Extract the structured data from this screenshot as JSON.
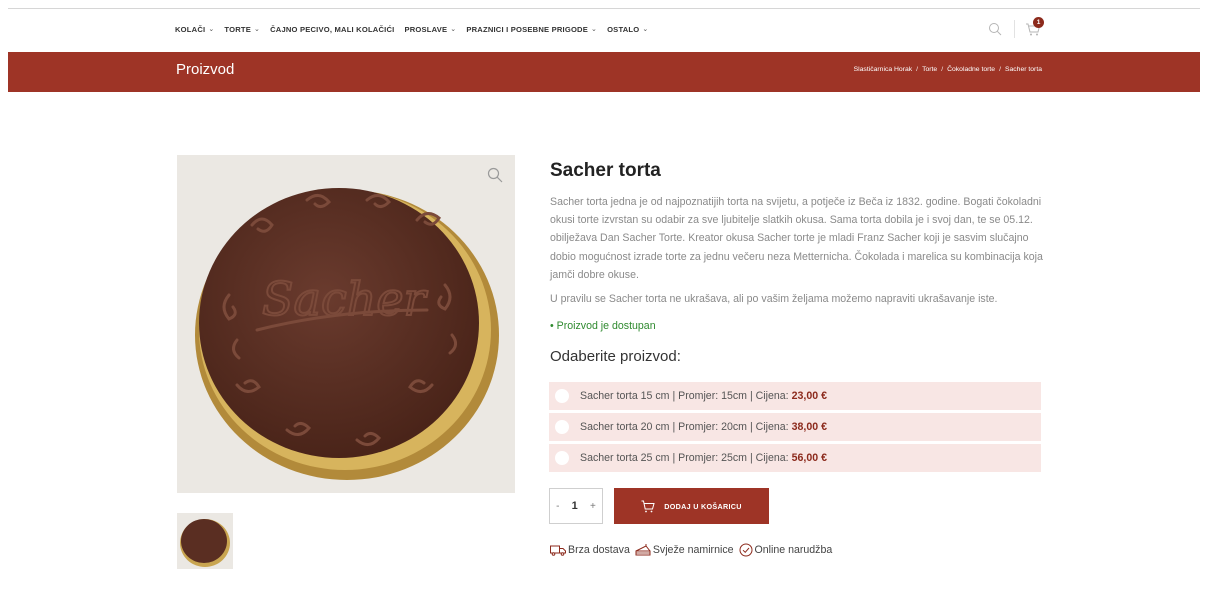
{
  "nav": {
    "items": [
      {
        "label": "KOLAČI",
        "has_dropdown": true
      },
      {
        "label": "TORTE",
        "has_dropdown": true
      },
      {
        "label": "ČAJNO PECIVO, MALI KOLAČIĆI",
        "has_dropdown": false
      },
      {
        "label": "PROSLAVE",
        "has_dropdown": true
      },
      {
        "label": "PRAZNICI I POSEBNE PRIGODE",
        "has_dropdown": true
      },
      {
        "label": "OSTALO",
        "has_dropdown": true
      }
    ],
    "cart_count": "1",
    "icons": [
      "search-icon",
      "cart-icon"
    ]
  },
  "banner": {
    "title": "Proizvod",
    "breadcrumb": [
      "Slastičarnica Horak",
      "Torte",
      "Čokoladne torte",
      "Sacher torta"
    ],
    "separator": "/"
  },
  "product": {
    "title": "Sacher torta",
    "description": "Sacher torta jedna je od najpoznatijih torta na svijetu, a potječe iz Beča iz 1832. godine. Bogati čokoladni okusi torte izvrstan su odabir za sve ljubitelje slatkih okusa. Sama torta dobila je i svoj dan, te se 05.12. obilježava Dan Sacher Torte. Kreator okusa Sacher torte je mladi Franz Sacher koji je sasvim slučajno dobio mogućnost izrade torte za jednu večeru neza Metternicha. Čokolada i marelica su kombinacija koja jamči dobre okuse.",
    "description2": "U pravilu se Sacher torta ne ukrašava, ali po vašim željama možemo napraviti ukrašavanje iste.",
    "stock": "• Proizvod je dostupan",
    "choose_label": "Odaberite proizvod:",
    "options": [
      {
        "label": "Sacher torta 15 cm | Promjer: 15cm | Cijena:",
        "price": "23,00 €"
      },
      {
        "label": "Sacher torta 20 cm | Promjer: 20cm | Cijena:",
        "price": "38,00 €"
      },
      {
        "label": "Sacher torta 25 cm | Promjer: 25cm | Cijena:",
        "price": "56,00 €"
      }
    ],
    "quantity": {
      "minus": "-",
      "value": "1",
      "plus": "+"
    },
    "add_to_cart": "DODAJ U KOŠARICU",
    "image_text": "Sacher"
  },
  "features": [
    {
      "icon": "truck-icon",
      "label": "Brza dostava"
    },
    {
      "icon": "cake-slice-icon",
      "label": "Svježe namirnice"
    },
    {
      "icon": "check-circle-icon",
      "label": "Online narudžba"
    }
  ],
  "colors": {
    "brand": "#9e3426",
    "option_bg": "#f8e6e4",
    "in_stock": "#2f8a2f"
  }
}
